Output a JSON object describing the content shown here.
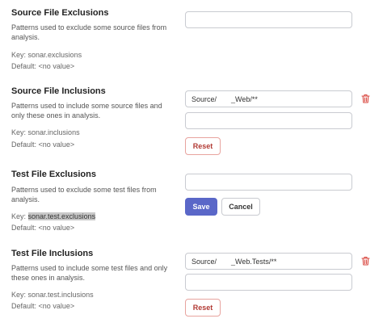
{
  "settings": [
    {
      "title": "Source File Exclusions",
      "description": "Patterns used to exclude some source files from analysis.",
      "key_label": "Key:",
      "key": "sonar.exclusions",
      "default_label": "Default:",
      "default": "<no value>",
      "values": [
        ""
      ]
    },
    {
      "title": "Source File Inclusions",
      "description": "Patterns used to include some source files and only these ones in analysis.",
      "key_label": "Key:",
      "key": "sonar.inclusions",
      "default_label": "Default:",
      "default": "<no value>",
      "values": [
        "Source/  _Web/**",
        ""
      ],
      "reset_label": "Reset"
    },
    {
      "title": "Test File Exclusions",
      "description": "Patterns used to exclude some test files from analysis.",
      "key_label": "Key:",
      "key": "sonar.test.exclusions",
      "default_label": "Default:",
      "default": "<no value>",
      "values": [
        ""
      ],
      "save_label": "Save",
      "cancel_label": "Cancel"
    },
    {
      "title": "Test File Inclusions",
      "description": "Patterns used to include some test files and only these ones in analysis.",
      "key_label": "Key:",
      "key": "sonar.test.inclusions",
      "default_label": "Default:",
      "default": "<no value>",
      "values": [
        "Source/  _Web.Tests/**",
        ""
      ],
      "reset_label": "Reset"
    }
  ],
  "colors": {
    "accent": "#5a67c8",
    "danger": "#b23a34",
    "key_highlight": "#c8c8c8"
  },
  "icons": {
    "delete": "trash-icon"
  }
}
